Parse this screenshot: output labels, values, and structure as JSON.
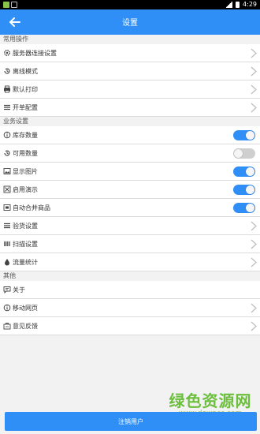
{
  "status_bar": {
    "time": "4:29"
  },
  "app_bar": {
    "title": "设置",
    "back_icon": "arrow-left-icon"
  },
  "sections": {
    "common": {
      "title": "常用操作",
      "items": [
        {
          "label": "服务器连接设置",
          "icon": "gear-icon"
        },
        {
          "label": "离线模式",
          "icon": "history-icon"
        },
        {
          "label": "默认打印",
          "icon": "printer-icon"
        },
        {
          "label": "开单配置",
          "icon": "menu-lines-icon"
        }
      ]
    },
    "business": {
      "title": "业务设置",
      "items": [
        {
          "label": "库存数量",
          "icon": "info-icon",
          "toggle": true
        },
        {
          "label": "可用数量",
          "icon": "history-icon",
          "toggle": false
        },
        {
          "label": "显示图片",
          "icon": "image-icon",
          "toggle": true
        },
        {
          "label": "启用演示",
          "icon": "demo-icon",
          "toggle": true
        },
        {
          "label": "自动合并商品",
          "icon": "merge-icon",
          "toggle": true
        },
        {
          "label": "验货设置",
          "icon": "menu-lines-icon"
        },
        {
          "label": "扫描设置",
          "icon": "barcode-icon"
        },
        {
          "label": "流量统计",
          "icon": "drop-icon"
        }
      ]
    },
    "other": {
      "title": "其他",
      "items": [
        {
          "label": "关于",
          "icon": "chat-icon"
        },
        {
          "label": "移动网页",
          "icon": "info-icon"
        },
        {
          "label": "意见反馈",
          "icon": "briefcase-icon"
        }
      ]
    }
  },
  "logout_button": {
    "label": "注销用户"
  },
  "watermark": {
    "text": "绿色资源网",
    "url": "www.downcc.com"
  },
  "colors": {
    "primary": "#2f8ff7",
    "toggle_off": "#cfcfcf",
    "watermark": "#6cbf3d"
  }
}
